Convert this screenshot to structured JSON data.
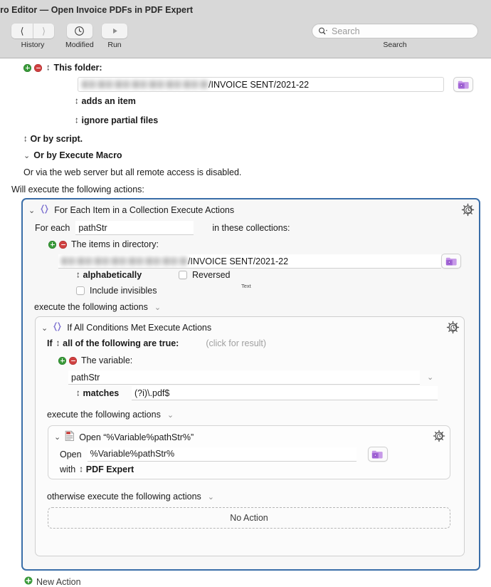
{
  "window": {
    "title": "tro Editor — Open Invoice PDFs in PDF Expert"
  },
  "toolbar": {
    "history_label": "History",
    "modified_label": "Modified",
    "run_label": "Run",
    "back_icon": "chevron-left-icon",
    "forward_icon": "chevron-right-icon",
    "modified_icon": "clock-icon",
    "run_icon": "play-icon",
    "search": {
      "placeholder": "Search",
      "value": "",
      "caption": "Search",
      "icon": "search-icon"
    }
  },
  "trigger": {
    "this_folder_label": "This folder:",
    "folder_path_redacted": "",
    "folder_path_visible": "/INVOICE SENT/2021-22",
    "folder_button_icon": "folder-gear-icon",
    "adds_an_item": "adds an item",
    "ignore_partial_files": "ignore partial files",
    "or_by_script": "Or by script.",
    "or_by_execute_macro": "Or by Execute Macro",
    "web_server_note": "Or via the web server but all remote access is disabled."
  },
  "actions_intro": "Will execute the following actions:",
  "for_each": {
    "title": "For Each Item in a Collection Execute Actions",
    "icon": "braces-icon",
    "gear_icon": "gear-clock-icon",
    "for_each_label": "For each",
    "variable_value": "pathStr",
    "in_collections_label": "in these collections:",
    "items_in_directory_label": "The items in directory:",
    "directory_path_redacted": "",
    "directory_path_visible": "/INVOICE SENT/2021-22",
    "directory_button_icon": "folder-gear-icon",
    "sort_order": "alphabetically",
    "reversed_label": "Reversed",
    "reversed_checked": false,
    "include_invisibles_label": "Include invisibles",
    "include_invisibles_checked": false,
    "text_badge": "Text",
    "execute_following_actions": "execute the following actions"
  },
  "if_block": {
    "title": "If All Conditions Met Execute Actions",
    "icon": "braces-icon",
    "gear_icon": "gear-clock-icon",
    "if_label": "If",
    "condition_mode": "all of the following are true:",
    "click_for_result": "(click for result)",
    "variable_section_label": "The variable:",
    "variable_name": "pathStr",
    "operator": "matches",
    "pattern": "(?i)\\.pdf$",
    "execute_following_actions": "execute the following actions",
    "otherwise_execute": "otherwise execute the following actions",
    "no_action": "No Action"
  },
  "open_action": {
    "title": "Open “%Variable%pathStr%”",
    "icon": "pdf-document-icon",
    "gear_icon": "gear-clock-icon",
    "open_label": "Open",
    "open_value": "%Variable%pathStr%",
    "file_button_icon": "folder-gear-icon",
    "with_label": "with",
    "app_name": "PDF Expert"
  },
  "footer": {
    "new_action": "New Action",
    "new_action_icon": "plus-circle-icon"
  },
  "colors": {
    "accent_blue": "#3a6ea8",
    "braces_purple": "#7b6fd0",
    "folder_purple": "#b07de0",
    "add_green": "#3a9a3a",
    "remove_red": "#cf4141",
    "toolbar_gray": "#d8d8d8"
  }
}
